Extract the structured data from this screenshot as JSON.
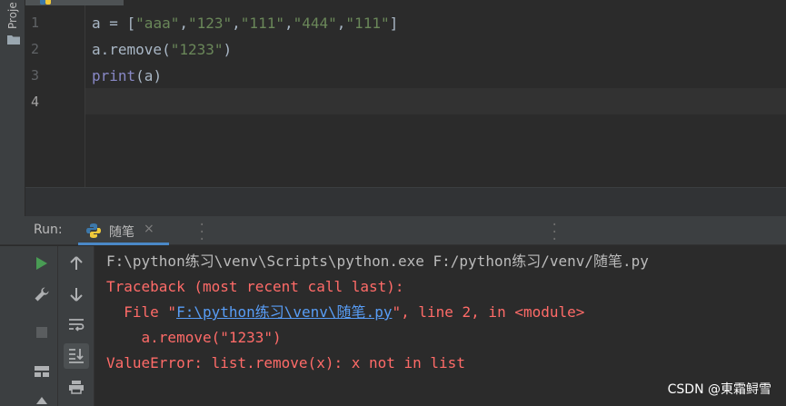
{
  "project_panel": {
    "label": "Proje"
  },
  "editor": {
    "line_numbers": [
      "1",
      "2",
      "3",
      "4"
    ]
  },
  "run_panel": {
    "label": "Run:",
    "tab_name": "随笔",
    "close_symbol": "×"
  },
  "console": {
    "command": "F:\\python练习\\venv\\Scripts\\python.exe F:/python练习/venv/随笔.py",
    "traceback": "Traceback (most recent call last):",
    "file_prefix": "  File \"",
    "file_link": "F:\\python练习\\venv\\随笔.py",
    "file_suffix": "\", line 2, in <module>",
    "code_line": "    a.remove(\"1233\")",
    "error": "ValueError: list.remove(x): x not in list"
  },
  "watermark": "CSDN @東霜鲟雪",
  "colors": {
    "editor_bg": "#2b2b2b",
    "panel_bg": "#3c3f41",
    "string": "#6a8759",
    "builtin": "#8888c6",
    "error": "#ff6b68",
    "link": "#589df6",
    "run_green": "#499c54"
  },
  "icons": [
    "folder-icon",
    "python-icon",
    "run-icon",
    "wrench-icon",
    "stop-icon",
    "layout-icon",
    "arrow-up-icon",
    "arrow-down-icon",
    "soft-wrap-icon",
    "scroll-to-end-icon",
    "print-icon"
  ]
}
